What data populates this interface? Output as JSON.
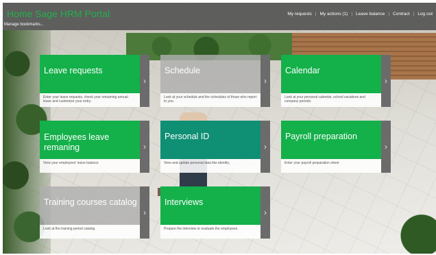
{
  "header": {
    "portal_title": "Home Sage HRM Portal",
    "manage_bookmarks": "Manage bookmarks...",
    "nav": [
      {
        "label": "My requests"
      },
      {
        "label": "My actions (1)"
      },
      {
        "label": "Leave balance"
      },
      {
        "label": "Contract"
      },
      {
        "label": "Log out"
      }
    ]
  },
  "tiles": [
    {
      "title": "Leave requests",
      "description": "Enter your leave requests, check your remaining annual leave and customize your entry.",
      "color": "#14b04a"
    },
    {
      "title": "Schedule",
      "description": "Look at your schedule and the schedules of those who report to you.",
      "color": "#afafaf"
    },
    {
      "title": "Calendar",
      "description": "Look at your personal calendar, school vacations and company periods.",
      "color": "#14b04a"
    },
    {
      "title": "Employees leave remaning",
      "description": "View your employees' leave balance",
      "color": "#14b04a"
    },
    {
      "title": "Personal ID",
      "description": "View and update personal data like identity,",
      "color": "#0f8f73"
    },
    {
      "title": "Payroll preparation",
      "description": "Enter your payroll preparation sheet",
      "color": "#14b04a"
    },
    {
      "title": "Training courses catalog",
      "description": "Look at the training period catalog",
      "color": "#afafaf"
    },
    {
      "title": "Interviews",
      "description": "Prepare the interview or evaluate the employees.",
      "color": "#14b04a"
    }
  ],
  "icons": {
    "tile_arrow": "chevron-right-icon"
  },
  "arrow_glyph": "›"
}
